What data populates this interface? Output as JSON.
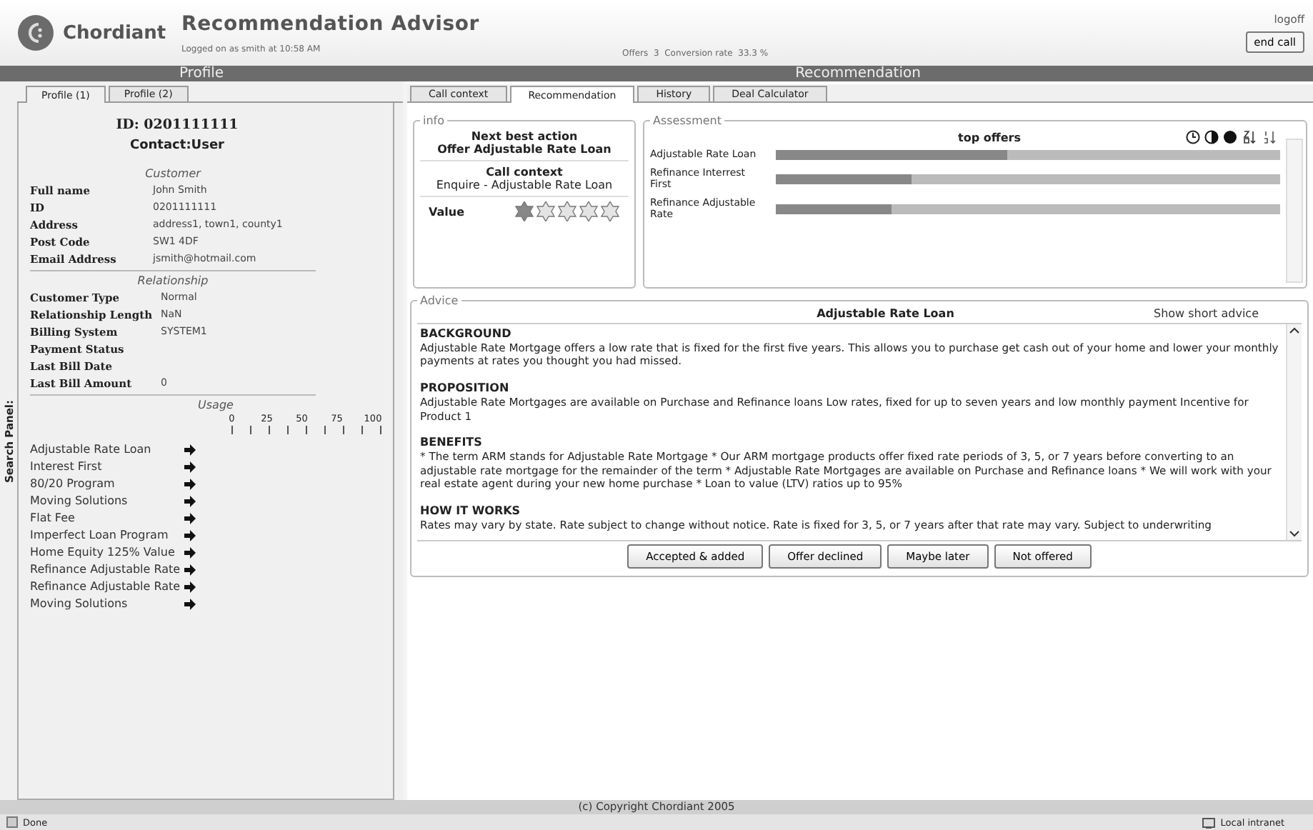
{
  "app": {
    "brand": "Chordiant",
    "title": "Recommendation Advisor",
    "login": "Logged on as smith at 10:58 AM",
    "stats": "Offers  3  Conversion rate  33.3 %",
    "logoff": "logoff",
    "end_call": "end call"
  },
  "headers": [
    "Profile",
    "Recommendation"
  ],
  "search_panel": "Search Panel:",
  "profile": {
    "tabs": [
      {
        "label": "Profile (1)",
        "selected": true
      },
      {
        "label": "Profile (2)",
        "selected": false
      }
    ],
    "id": "ID: 0201111111",
    "contact": "Contact:User",
    "sections": [
      {
        "title": "Customer",
        "fields": [
          {
            "label": "Full name",
            "value": "John Smith"
          },
          {
            "label": "ID",
            "value": "0201111111"
          },
          {
            "label": "Address",
            "value": "address1, town1, county1"
          },
          {
            "label": "Post Code",
            "value": "SW1 4DF"
          },
          {
            "label": "Email Address",
            "value": "jsmith@hotmail.com"
          }
        ]
      },
      {
        "title": "Relationship",
        "fields": [
          {
            "label": "Customer Type",
            "value": "Normal"
          },
          {
            "label": "Relationship Length",
            "value": "NaN"
          },
          {
            "label": "Billing System",
            "value": "SYSTEM1"
          },
          {
            "label": "Payment Status"
          },
          {
            "label": "Last Bill Date"
          },
          {
            "label": "Last Bill Amount",
            "value": "0"
          }
        ]
      }
    ],
    "usage": {
      "title": "Usage",
      "ticks": [
        "0",
        "25",
        "50",
        "75",
        "100"
      ],
      "items": [
        "Adjustable Rate Loan",
        "Interest First",
        "80/20 Program",
        "Moving Solutions",
        "Flat Fee",
        "Imperfect Loan Program",
        "Home Equity 125% Value",
        "Refinance Adjustable Rate",
        "Refinance Adjustable Rate",
        "Moving Solutions"
      ]
    }
  },
  "recommendation": {
    "tabs": [
      {
        "label": "Call context",
        "selected": false
      },
      {
        "label": "Recommendation",
        "selected": true
      },
      {
        "label": "History",
        "selected": false
      },
      {
        "label": "Deal Calculator",
        "selected": false
      }
    ],
    "info": {
      "legend": "info",
      "next_label": "Next best action",
      "next_value": "Offer Adjustable Rate Loan",
      "context_label": "Call context",
      "context_value": "Enquire - Adjustable Rate Loan",
      "value_label": "Value",
      "stars": 1
    },
    "assessment": {
      "legend": "Assessment",
      "title": "top offers",
      "offers": [
        {
          "name": "Adjustable Rate Loan",
          "level": 0.46
        },
        {
          "name": "Refinance Interrest First",
          "level": 0.27
        },
        {
          "name": "Refinance Adjustable Rate",
          "level": 0.23
        }
      ]
    },
    "advice": {
      "legend": "Advice",
      "title": "Adjustable Rate Loan",
      "toggle": "Show short advice",
      "sections": [
        {
          "heading": "BACKGROUND",
          "text": "Adjustable Rate Mortgage offers a low rate that is fixed for the first five years. This allows you to purchase get cash out of your home and lower your monthly payments at rates you thought you had missed."
        },
        {
          "heading": "PROPOSITION",
          "text": "Adjustable Rate Mortgages are available on Purchase and Refinance loans Low rates, fixed for up to seven years and low monthly payment Incentive for Product 1"
        },
        {
          "heading": "BENEFITS",
          "text": "* The term ARM stands for Adjustable Rate Mortgage * Our ARM mortgage products offer fixed rate periods of 3, 5, or 7 years before converting to an adjustable rate mortgage for the remainder of the term * Adjustable Rate Mortgages are available on Purchase and Refinance loans * We will work with your real estate agent during your new home purchase * Loan to value (LTV) ratios up to 95%"
        },
        {
          "heading": "HOW IT WORKS",
          "text": "Rates may vary by state. Rate subject to change without notice. Rate is fixed for 3, 5, or 7 years after that rate may vary. Subject to underwriting"
        }
      ],
      "buttons": [
        "Accepted & added",
        "Offer declined",
        "Maybe later",
        "Not offered"
      ]
    }
  },
  "copyright": "(c) Copyright Chordiant 2005",
  "status": {
    "left": "Done",
    "right": "Local intranet"
  }
}
